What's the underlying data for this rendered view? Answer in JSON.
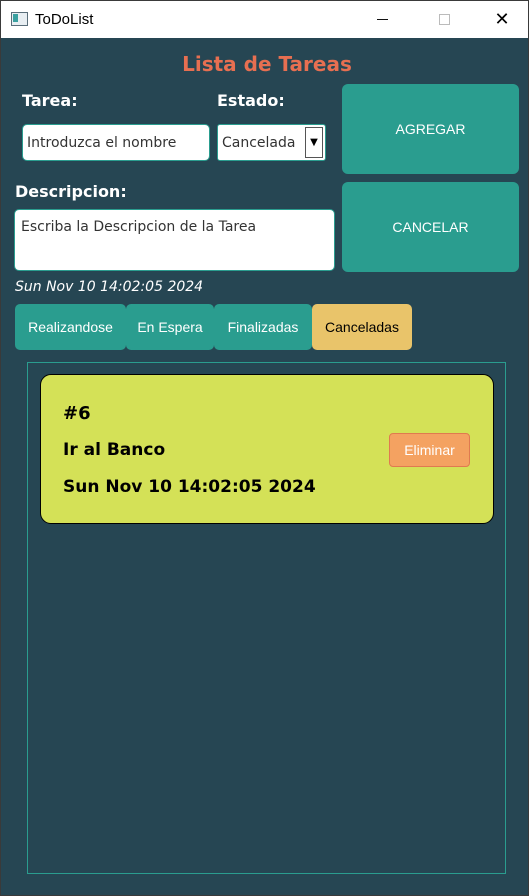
{
  "window": {
    "title": "ToDoList",
    "close_glyph": "✕"
  },
  "header": {
    "title": "Lista de Tareas"
  },
  "form": {
    "tarea_label": "Tarea:",
    "estado_label": "Estado:",
    "descripcion_label": "Descripcion:",
    "nombre_input": {
      "value": "Introduzca el nombre"
    },
    "estado_select": {
      "selected": "Cancelada",
      "arrow": "▼"
    },
    "descripcion_input": {
      "value": "Escriba la Descripcion de la Tarea"
    }
  },
  "buttons": {
    "agregar": "AGREGAR",
    "cancelar": "CANCELAR"
  },
  "current_datetime": "Sun Nov 10 14:02:05 2024",
  "tabs": [
    {
      "label": "Realizandose",
      "active": false
    },
    {
      "label": "En Espera",
      "active": false
    },
    {
      "label": "Finalizadas",
      "active": false
    },
    {
      "label": "Canceladas",
      "active": true
    }
  ],
  "tasks": [
    {
      "id": "#6",
      "name": "Ir al Banco",
      "date": "Sun Nov 10 14:02:05 2024",
      "delete_label": "Eliminar"
    }
  ],
  "colors": {
    "background": "#264653",
    "accent": "#2a9d8f",
    "heading": "#e76f51",
    "active_tab": "#e9c46a",
    "card": "#d4e157",
    "delete": "#f4a261"
  },
  "icons": {
    "app": "app-window-icon",
    "minimize": "minimize-icon",
    "maximize": "maximize-icon",
    "close": "close-icon",
    "dropdown": "chevron-down-icon"
  }
}
